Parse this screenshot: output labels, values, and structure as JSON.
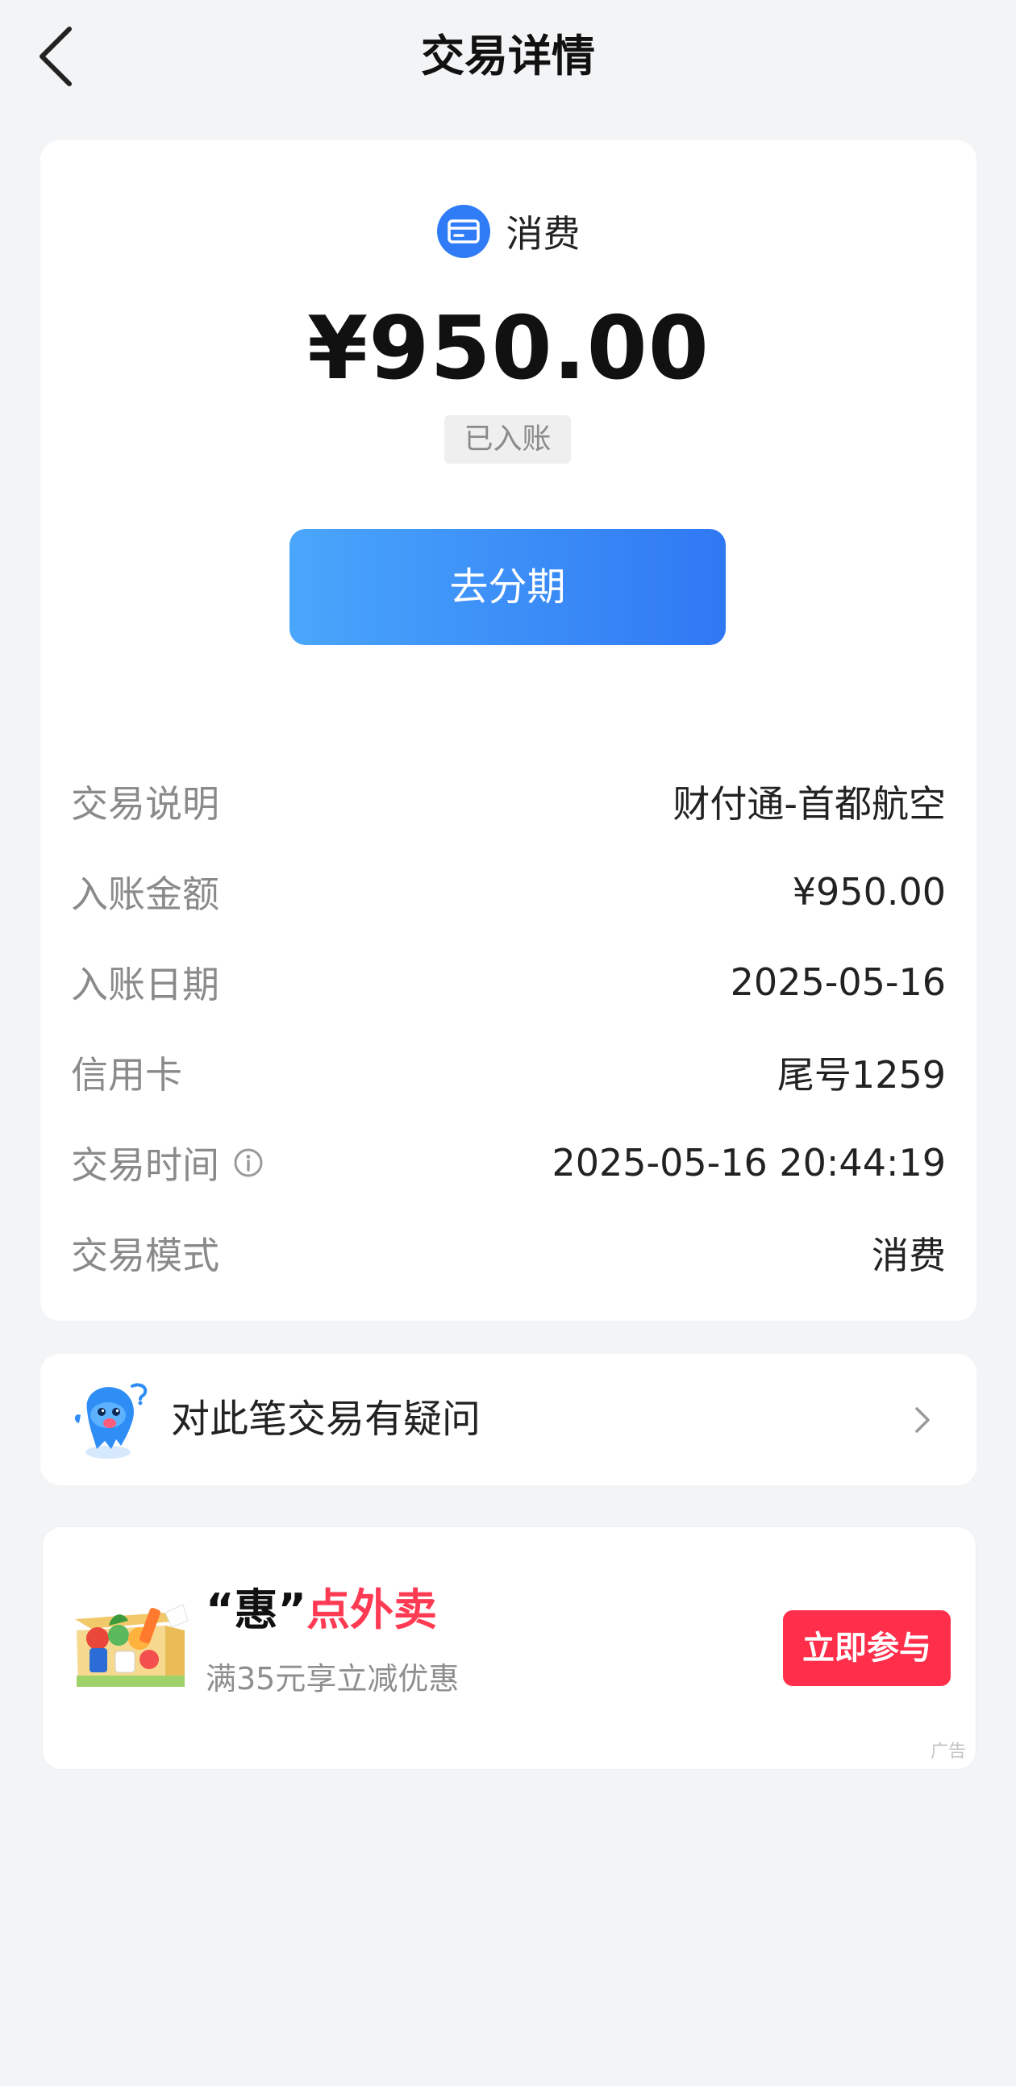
{
  "header": {
    "title": "交易详情",
    "back_icon": "chevron-left-icon"
  },
  "summary": {
    "type_icon": "credit-card-icon",
    "type_label": "消费",
    "amount": "¥950.00",
    "status": "已入账",
    "installment_label": "去分期"
  },
  "details": [
    {
      "label": "交易说明",
      "value": "财付通-首都航空"
    },
    {
      "label": "入账金额",
      "value": "¥950.00"
    },
    {
      "label": "入账日期",
      "value": "2025-05-16"
    },
    {
      "label": "信用卡",
      "value": "尾号1259"
    },
    {
      "label": "交易时间",
      "value": "2025-05-16 20:44:19"
    },
    {
      "label": "交易模式",
      "value": "消费"
    }
  ],
  "question": {
    "text": "对此笔交易有疑问",
    "icon": "mascot-icon"
  },
  "ad": {
    "title_prefix": "“惠”",
    "title_highlight": "点外卖",
    "subtitle": "满35元享立减优惠",
    "button_label": "立即参与",
    "tag": "广告"
  },
  "colors": {
    "accent_blue": "#2f7cf6",
    "ad_red": "#ff2f4b",
    "background": "#f3f4f6"
  }
}
